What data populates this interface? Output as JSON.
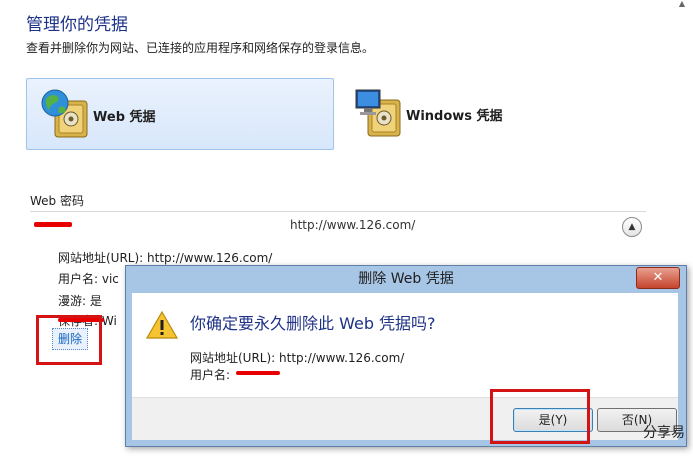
{
  "header": {
    "title": "管理你的凭据",
    "description": "查看并删除你为网站、已连接的应用程序和网络保存的登录信息。"
  },
  "tiles": {
    "web_label": "Web 凭据",
    "windows_label": "Windows 凭据"
  },
  "section": {
    "title": "Web 密码",
    "entry_url": "http://www.126.com/",
    "collapse_icon": "chevron-up-icon",
    "details": {
      "site": "网站地址(URL): http://www.126.com/",
      "user": "用户名: vic",
      "roaming": "漫游: 是",
      "saved_by": "保存者: Wi"
    },
    "delete_label": "删除"
  },
  "dialog": {
    "title": "删除 Web 凭据",
    "close_label": "✕",
    "question": "你确定要永久删除此 Web 凭据吗?",
    "site_line": "网站地址(URL): http://www.126.com/",
    "user_line": "用户名:",
    "yes_label": "是(Y)",
    "no_label": "否(N)"
  },
  "watermark": "分享易",
  "colors": {
    "title_blue": "#1e3287",
    "highlight_red": "#d41414",
    "dialog_frame": "#a7c6e6"
  }
}
